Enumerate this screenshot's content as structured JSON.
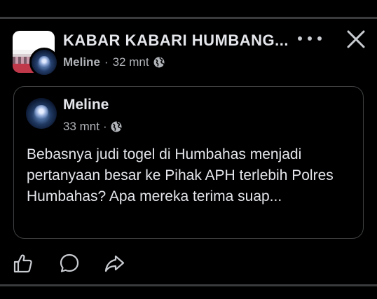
{
  "post": {
    "group_name": "KABAR KABARI HUMBANG...",
    "author": "Meline",
    "time": "32 mnt",
    "separator": "·",
    "privacy_icon": "globe-icon"
  },
  "shared_post": {
    "author": "Meline",
    "time": "33 mnt",
    "separator": "·",
    "privacy_icon": "globe-icon",
    "text": "Bebasnya judi togel di Humbahas menjadi pertanyaan besar ke Pihak APH terlebih Polres Humbahas? Apa mereka terima suap..."
  },
  "header_actions": {
    "more_icon": "more-horizontal-icon",
    "close_icon": "close-icon"
  },
  "actions": {
    "like_icon": "thumbs-up-icon",
    "comment_icon": "comment-icon",
    "share_icon": "share-icon"
  },
  "colors": {
    "background": "#000000",
    "primary_text": "#e4e6eb",
    "secondary_text": "#b0b3b8",
    "divider": "#3a3b3c",
    "card_border": "#3e4042"
  }
}
